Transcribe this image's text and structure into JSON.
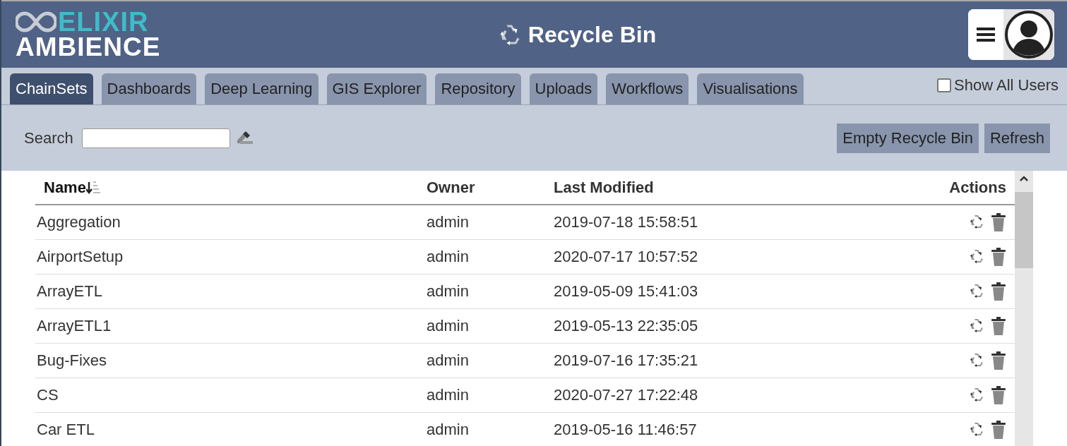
{
  "header": {
    "logo_top": "ELIXIR",
    "logo_bottom": "AMBIENCE",
    "title": "Recycle Bin"
  },
  "tabs": [
    {
      "label": "ChainSets",
      "selected": true
    },
    {
      "label": "Dashboards",
      "selected": false
    },
    {
      "label": "Deep Learning",
      "selected": false
    },
    {
      "label": "GIS Explorer",
      "selected": false
    },
    {
      "label": "Repository",
      "selected": false
    },
    {
      "label": "Uploads",
      "selected": false
    },
    {
      "label": "Workflows",
      "selected": false
    },
    {
      "label": "Visualisations",
      "selected": false
    }
  ],
  "show_all_users": {
    "label": "Show All Users",
    "checked": false
  },
  "toolbar": {
    "search_label": "Search",
    "buttons": [
      "Empty Recycle Bin",
      "Refresh"
    ]
  },
  "table": {
    "columns": [
      {
        "label": "Name",
        "sorted": true
      },
      {
        "label": "Owner",
        "sorted": false
      },
      {
        "label": "Last Modified",
        "sorted": false
      },
      {
        "label": "Actions",
        "sorted": false
      }
    ],
    "rows": [
      {
        "name": "Aggregation",
        "owner": "admin",
        "modified": "2019-07-18 15:58:51"
      },
      {
        "name": "AirportSetup",
        "owner": "admin",
        "modified": "2020-07-17 10:57:52"
      },
      {
        "name": "ArrayETL",
        "owner": "admin",
        "modified": "2019-05-09 15:41:03"
      },
      {
        "name": "ArrayETL1",
        "owner": "admin",
        "modified": "2019-05-13 22:35:05"
      },
      {
        "name": "Bug-Fixes",
        "owner": "admin",
        "modified": "2019-07-16 17:35:21"
      },
      {
        "name": "CS",
        "owner": "admin",
        "modified": "2020-07-27 17:22:48"
      },
      {
        "name": "Car ETL",
        "owner": "admin",
        "modified": "2019-05-16 11:46:57"
      }
    ]
  }
}
